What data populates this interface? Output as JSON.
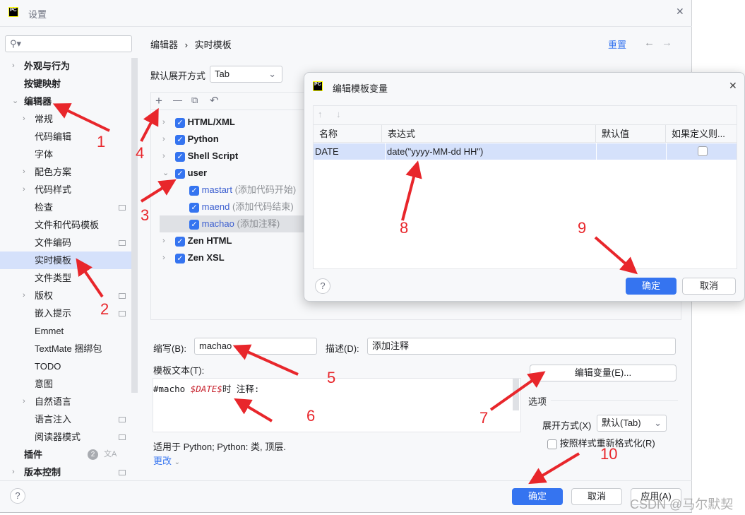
{
  "window": {
    "title": "设置",
    "close": "✕"
  },
  "search": {
    "placeholder": ""
  },
  "sidebar": {
    "items": [
      {
        "label": "外观与行为",
        "level": 0,
        "chevron": "›"
      },
      {
        "label": "按键映射",
        "level": 0
      },
      {
        "label": "编辑器",
        "level": 0,
        "chevron": "⌄",
        "expanded": true
      },
      {
        "label": "常规",
        "level": 1,
        "chevron": "›"
      },
      {
        "label": "代码编辑",
        "level": 1
      },
      {
        "label": "字体",
        "level": 1
      },
      {
        "label": "配色方案",
        "level": 1,
        "chevron": "›"
      },
      {
        "label": "代码样式",
        "level": 1,
        "chevron": "›"
      },
      {
        "label": "检查",
        "level": 1,
        "icon": true
      },
      {
        "label": "文件和代码模板",
        "level": 1
      },
      {
        "label": "文件编码",
        "level": 1,
        "icon": true
      },
      {
        "label": "实时模板",
        "level": 1,
        "selected": true
      },
      {
        "label": "文件类型",
        "level": 1
      },
      {
        "label": "版权",
        "level": 1,
        "chevron": "›",
        "icon": true
      },
      {
        "label": "嵌入提示",
        "level": 1,
        "icon": true
      },
      {
        "label": "Emmet",
        "level": 1
      },
      {
        "label": "TextMate 捆绑包",
        "level": 1
      },
      {
        "label": "TODO",
        "level": 1
      },
      {
        "label": "意图",
        "level": 1
      },
      {
        "label": "自然语言",
        "level": 1,
        "chevron": "›"
      },
      {
        "label": "语言注入",
        "level": 1,
        "icon": true
      },
      {
        "label": "阅读器模式",
        "level": 1,
        "icon": true
      },
      {
        "label": "插件",
        "level": 0,
        "badge": "2"
      },
      {
        "label": "版本控制",
        "level": 0,
        "chevron": "›",
        "icon": true
      }
    ]
  },
  "breadcrumb": {
    "parent": "编辑器",
    "sep": "›",
    "current": "实时模板",
    "reset": "重置",
    "back": "←",
    "forward": "→"
  },
  "expand": {
    "label": "默认展开方式",
    "value": "Tab"
  },
  "toolbar": {
    "add": "+",
    "remove": "—",
    "copy": "⧉",
    "undo": "↶"
  },
  "templates": [
    {
      "label": "HTML/XML",
      "group": true
    },
    {
      "label": "Python",
      "group": true
    },
    {
      "label": "Shell Script",
      "group": true
    },
    {
      "label": "user",
      "group": true,
      "expanded": true
    },
    {
      "label": "mastart",
      "desc": "(添加代码开始)"
    },
    {
      "label": "maend",
      "desc": "(添加代码结束)"
    },
    {
      "label": "machao",
      "desc": "(添加注释)",
      "selected": true
    },
    {
      "label": "Zen HTML",
      "group": true
    },
    {
      "label": "Zen XSL",
      "group": true
    }
  ],
  "form": {
    "abbr_label": "缩写(B):",
    "abbr_value": "machao",
    "desc_label": "描述(D):",
    "desc_value": "添加注释",
    "text_label": "模板文本(T):",
    "text_prefix": "#macho ",
    "text_var": "$DATE$",
    "text_suffix": "时 注释:",
    "edit_vars": "编辑变量(E)...",
    "options_label": "选项",
    "expand_label": "展开方式(X)",
    "expand_value": "默认(Tab)",
    "reformat_label": "按照样式重新格式化(R)",
    "applicable": "适用于 Python; Python: 类, 顶层.",
    "change": "更改"
  },
  "footer": {
    "help": "?",
    "ok": "确定",
    "cancel": "取消",
    "apply": "应用(A)"
  },
  "modal": {
    "title": "编辑模板变量",
    "close": "✕",
    "up": "↑",
    "down": "↓",
    "columns": [
      "名称",
      "表达式",
      "默认值",
      "如果定义则..."
    ],
    "rows": [
      {
        "name": "DATE",
        "expression": "date(\"yyyy-MM-dd HH\")",
        "default": "",
        "skip": false
      }
    ],
    "help": "?",
    "ok": "确定",
    "cancel": "取消"
  },
  "annotations": [
    "1",
    "2",
    "3",
    "4",
    "5",
    "6",
    "7",
    "8",
    "9",
    "10"
  ],
  "watermark": "CSDN @马尔默契",
  "colors": {
    "accent": "#3574f0",
    "selection": "#d5e1fb",
    "annotation": "#e8262b",
    "variable": "#c7222d"
  }
}
